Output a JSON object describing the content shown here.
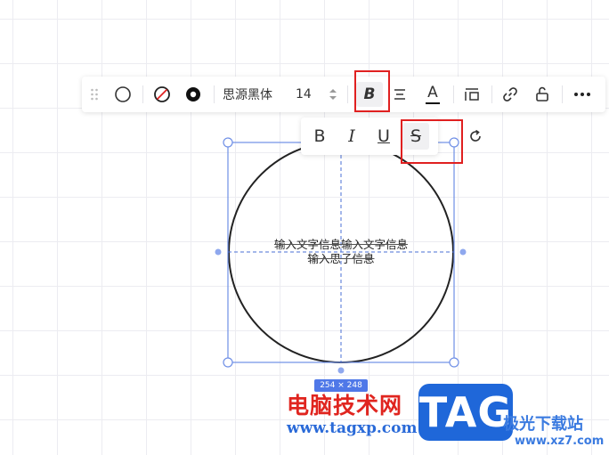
{
  "toolbar": {
    "font_name": "思源黑体",
    "font_size": "14",
    "icons": [
      "drag-handle-icon",
      "circle-shape-icon",
      "no-fill-icon",
      "stroke-color-icon",
      "stepper-icon",
      "bold-icon",
      "align-icon",
      "font-color-icon",
      "layout-icon",
      "link-icon",
      "unlock-icon",
      "more-icon"
    ],
    "bold_glyph": "B",
    "font_color_glyph": "A"
  },
  "text_format": {
    "bold": "B",
    "italic": "I",
    "underline": "U",
    "strikethrough": "S",
    "active": "strikethrough"
  },
  "shape": {
    "text_line1": "输入文字信息输入文字信息",
    "text_line2": "输入思子信息",
    "dimensions": "254 × 248"
  },
  "watermark": {
    "site_name_cn": "电脑技术网",
    "url": "www.tagxp.com",
    "tag": "TAG",
    "site2_cn": "极光下载站",
    "site2_url": "www.xz7.com"
  },
  "colors": {
    "selection": "#6f8fe6",
    "highlight_box": "#e02020",
    "badge": "#4f78e8"
  }
}
